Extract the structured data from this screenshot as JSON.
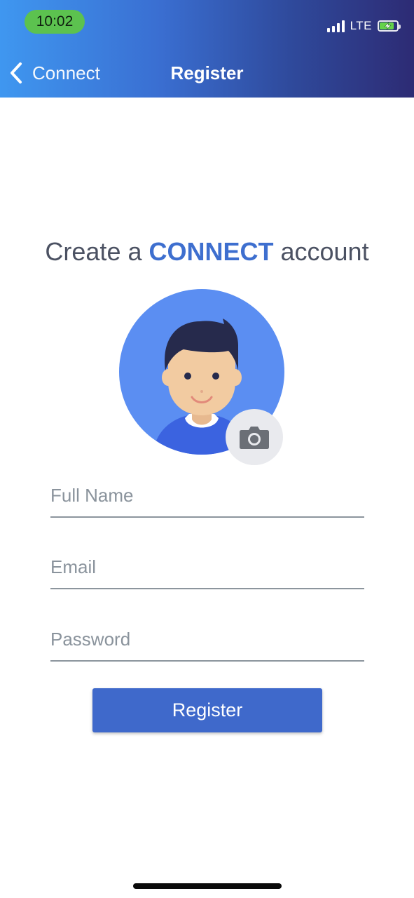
{
  "status_bar": {
    "time": "10:02",
    "network": "LTE",
    "time_pill_color": "#5cc24f",
    "icons": [
      "signal-icon",
      "battery-charging-icon"
    ]
  },
  "nav": {
    "back_label": "Connect",
    "title": "Register",
    "gradient": [
      "#3f97f0",
      "#2d2b74"
    ]
  },
  "headline": {
    "prefix": "Create a ",
    "brand": "CONNECT",
    "suffix": " account",
    "brand_color": "#3e6fcf"
  },
  "avatar": {
    "icons": [
      "avatar-illustration",
      "camera-icon"
    ],
    "circle_color": "#5b8ef2"
  },
  "form": {
    "full_name_placeholder": "Full Name",
    "email_placeholder": "Email",
    "password_placeholder": "Password",
    "full_name_value": "",
    "email_value": "",
    "password_value": "",
    "submit_label": "Register",
    "button_color": "#3f69cb"
  }
}
